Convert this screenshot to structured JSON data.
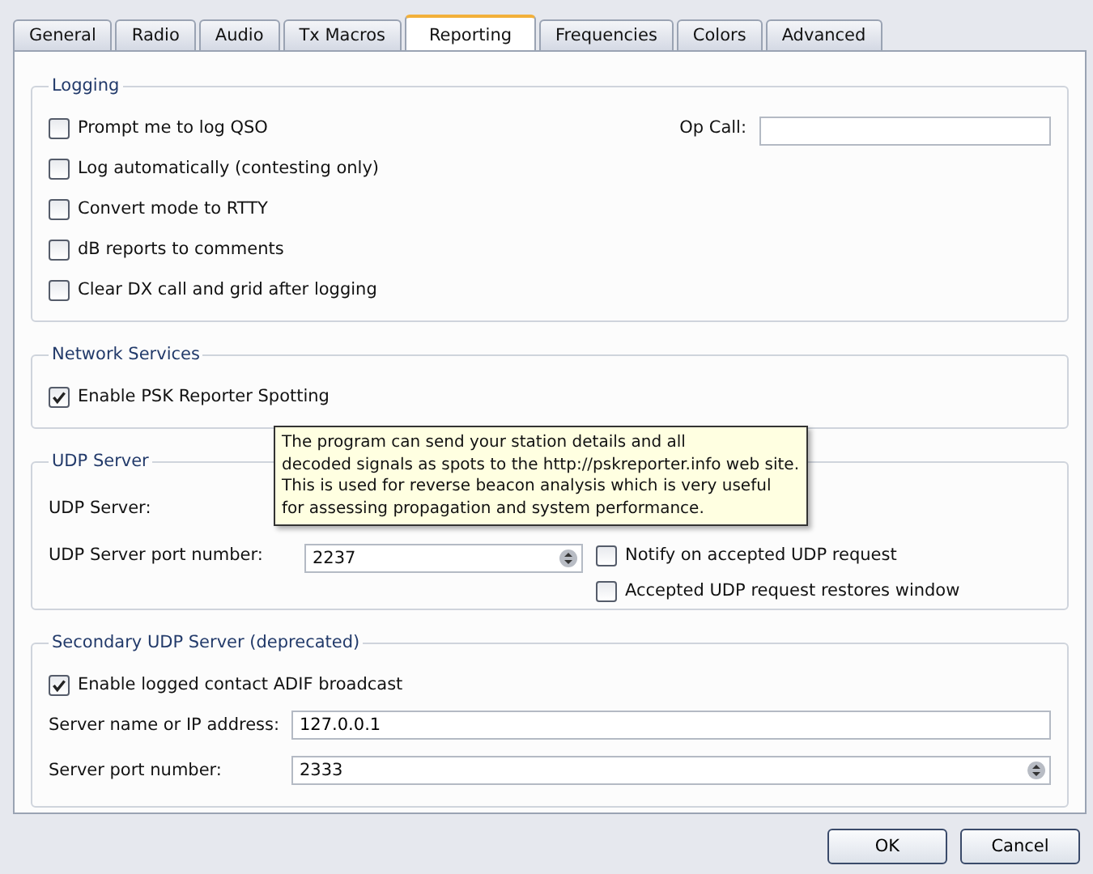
{
  "tabs": [
    {
      "label": "General",
      "selected": false
    },
    {
      "label": "Radio",
      "selected": false
    },
    {
      "label": "Audio",
      "selected": false
    },
    {
      "label": "Tx Macros",
      "selected": false
    },
    {
      "label": "Reporting",
      "selected": true
    },
    {
      "label": "Frequencies",
      "selected": false
    },
    {
      "label": "Colors",
      "selected": false
    },
    {
      "label": "Advanced",
      "selected": false
    }
  ],
  "logging": {
    "title": "Logging",
    "options": [
      {
        "label": "Prompt me to log QSO",
        "checked": false
      },
      {
        "label": "Log automatically (contesting only)",
        "checked": false
      },
      {
        "label": "Convert mode to RTTY",
        "checked": false
      },
      {
        "label": "dB reports to comments",
        "checked": false
      },
      {
        "label": "Clear DX call and grid after logging",
        "checked": false
      }
    ],
    "op_call": {
      "label": "Op Call:"
    }
  },
  "network_services": {
    "title": "Network Services",
    "option": {
      "label": "Enable PSK Reporter Spotting",
      "checked": true
    }
  },
  "tooltip": {
    "lines": [
      "The program can send your station details and all",
      "decoded signals as spots to the http://pskreporter.info web site.",
      "This is used for reverse beacon analysis which is very useful",
      "for assessing propagation and system performance."
    ]
  },
  "udp_server": {
    "title": "UDP Server",
    "server_label": "UDP Server:",
    "port_label": "UDP Server port number:",
    "port_value": "2237",
    "options": [
      {
        "label": "Notify on accepted UDP request",
        "checked": false
      },
      {
        "label": "Accepted UDP request restores window",
        "checked": false
      }
    ]
  },
  "secondary_udp": {
    "title": "Secondary UDP Server (deprecated)",
    "option": {
      "label": "Enable logged contact ADIF broadcast",
      "checked": true
    },
    "address_label": "Server name or IP address:",
    "address_value": "127.0.0.1",
    "port_label": "Server port number:",
    "port_value": "2333"
  },
  "buttons": [
    "OK",
    "Cancel"
  ]
}
